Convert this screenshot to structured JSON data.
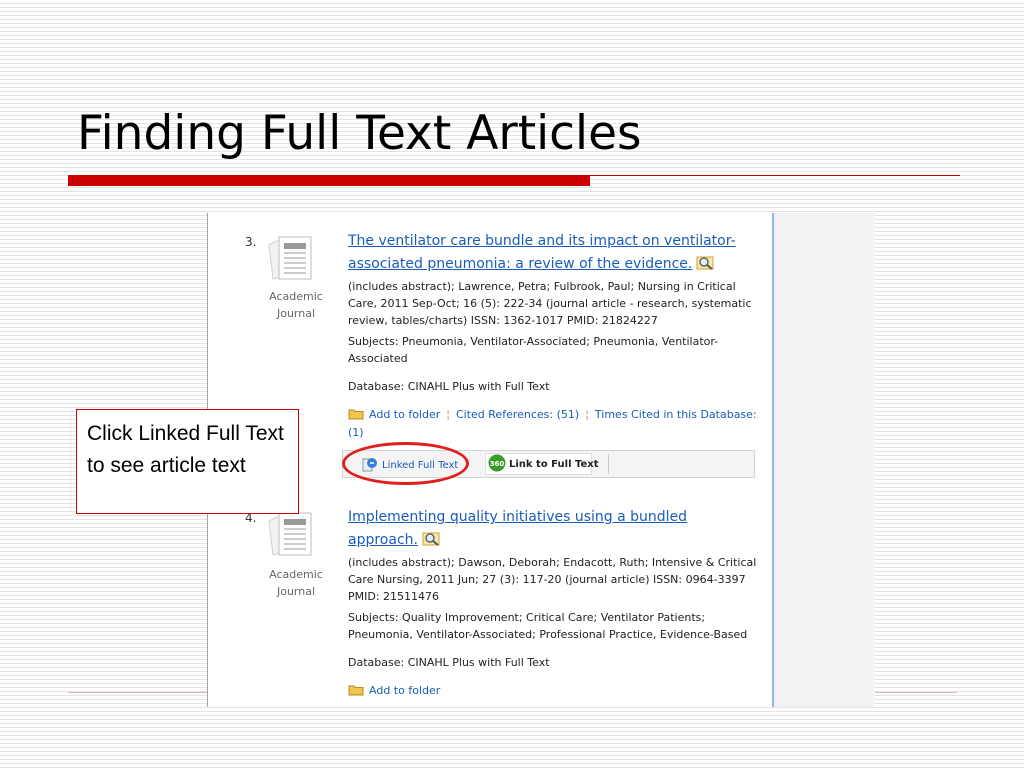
{
  "slide": {
    "title": "Finding Full Text Articles",
    "callout": "Click Linked Full Text to see article text"
  },
  "results": [
    {
      "number": "3.",
      "doc_type": "Academic Journal",
      "title": "The ventilator care bundle and its impact on ventilator-associated pneumonia: a review of the evidence.",
      "citation": "(includes abstract); Lawrence, Petra; Fulbrook, Paul; Nursing in Critical Care, 2011 Sep-Oct; 16 (5): 222-34 (journal article - research, systematic review, tables/charts) ISSN: 1362-1017 PMID: 21824227",
      "subjects": "Subjects: Pneumonia, Ventilator-Associated; Pneumonia, Ventilator-Associated",
      "database": "Database: CINAHL Plus with Full Text",
      "add_to_folder": "Add to folder",
      "cited_references": "Cited References: (51)",
      "times_cited": "Times Cited in this Database:",
      "times_cited_count": "(1)",
      "linked_full_text": "Linked Full Text",
      "link_to_full_text": "Link to Full Text",
      "badge_360": "360"
    },
    {
      "number": "4.",
      "doc_type": "Academic Journal",
      "title": "Implementing quality initiatives using a bundled approach.",
      "citation": "(includes abstract); Dawson, Deborah; Endacott, Ruth; Intensive & Critical Care Nursing, 2011 Jun; 27 (3): 117-20 (journal article) ISSN: 0964-3397 PMID: 21511476",
      "subjects": "Subjects: Quality Improvement; Critical Care; Ventilator Patients; Pneumonia, Ventilator-Associated; Professional Practice, Evidence-Based",
      "database": "Database: CINAHL Plus with Full Text",
      "add_to_folder": "Add to folder"
    }
  ],
  "colors": {
    "accent_red": "#cc0000",
    "link_blue": "#1a5cb8",
    "highlight_circle": "#e01f1f",
    "badge_green": "#3a9a2a"
  },
  "icons": [
    "document-icon",
    "magnifier-icon",
    "folder-icon",
    "full-text-icon",
    "badge-360-icon"
  ]
}
